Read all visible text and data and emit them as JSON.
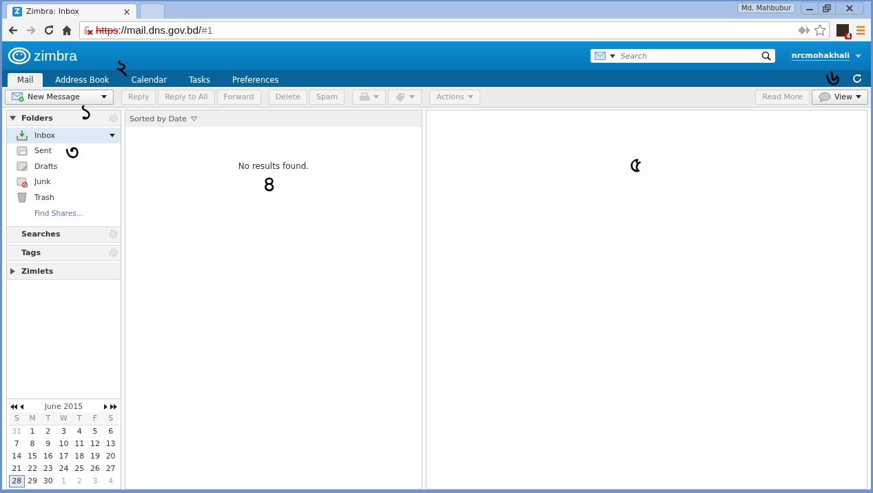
{
  "browser": {
    "tabs": [
      {
        "favicon": "Z",
        "title": "Zimbra: Inbox",
        "close": "×",
        "selected": true
      },
      {
        "selected": false
      }
    ],
    "profile": "Md. Mahbubur",
    "url": {
      "scheme": "https",
      "rest": "://mail.dns.gov.bd/",
      "hash": "#1"
    },
    "extension_badge": "4"
  },
  "header": {
    "logo": "zimbra",
    "search": {
      "placeholder": "Search"
    },
    "user": "nrcmohakhali"
  },
  "app_tabs": [
    {
      "label": "Mail",
      "selected": true
    },
    {
      "label": "Address Book",
      "selected": false
    },
    {
      "label": "Calendar",
      "selected": false
    },
    {
      "label": "Tasks",
      "selected": false
    },
    {
      "label": "Preferences",
      "selected": false
    }
  ],
  "toolbar": {
    "left": [
      {
        "kind": "text",
        "label": "New Message",
        "menu": true,
        "disabled": false
      },
      {
        "kind": "text",
        "label": "Reply",
        "disabled": true
      },
      {
        "kind": "text",
        "label": "Reply to All",
        "disabled": true
      },
      {
        "kind": "text",
        "label": "Forward",
        "disabled": true
      },
      {
        "kind": "text",
        "label": "Delete",
        "disabled": true
      },
      {
        "kind": "text",
        "label": "Spam",
        "disabled": true
      },
      {
        "kind": "icon",
        "menu": true,
        "disabled": true
      },
      {
        "kind": "icon",
        "menu": true,
        "disabled": true
      },
      {
        "kind": "text",
        "label": "Actions",
        "menu": true,
        "disabled": true
      }
    ],
    "right": [
      {
        "kind": "text",
        "label": "Read More",
        "disabled": true
      },
      {
        "kind": "text",
        "label": "View",
        "menu": true,
        "disabled": false
      }
    ]
  },
  "sidebar": {
    "folders_title": "Folders",
    "expanded": true,
    "folders": [
      {
        "name": "Inbox",
        "selected": true
      },
      {
        "name": "Sent",
        "selected": false
      },
      {
        "name": "Drafts",
        "selected": false
      },
      {
        "name": "Junk",
        "selected": false
      },
      {
        "name": "Trash",
        "selected": false
      }
    ],
    "find_shares": "Find Shares...",
    "sections": [
      {
        "title": "Searches",
        "gear": true
      },
      {
        "title": "Tags",
        "gear": true
      },
      {
        "title": "Zimlets",
        "expanded": false,
        "gear": false
      }
    ]
  },
  "calendar": {
    "month": "June 2015",
    "weekdays": [
      "S",
      "M",
      "T",
      "W",
      "T",
      "F",
      "S"
    ],
    "weeks": [
      [
        {
          "d": "31",
          "muted": true,
          "selected": false
        },
        {
          "d": "1",
          "muted": false,
          "selected": false
        },
        {
          "d": "2",
          "muted": false,
          "selected": false
        },
        {
          "d": "3",
          "muted": false,
          "selected": false
        },
        {
          "d": "4",
          "muted": false,
          "selected": false
        },
        {
          "d": "5",
          "muted": false,
          "selected": false
        },
        {
          "d": "6",
          "muted": false,
          "selected": false
        }
      ],
      [
        {
          "d": "7",
          "muted": false,
          "selected": false
        },
        {
          "d": "8",
          "muted": false,
          "selected": false
        },
        {
          "d": "9",
          "muted": false,
          "selected": false
        },
        {
          "d": "10",
          "muted": false,
          "selected": false
        },
        {
          "d": "11",
          "muted": false,
          "selected": false
        },
        {
          "d": "12",
          "muted": false,
          "selected": false
        },
        {
          "d": "13",
          "muted": false,
          "selected": false
        }
      ],
      [
        {
          "d": "14",
          "muted": false,
          "selected": false
        },
        {
          "d": "15",
          "muted": false,
          "selected": false
        },
        {
          "d": "16",
          "muted": false,
          "selected": false
        },
        {
          "d": "17",
          "muted": false,
          "selected": false
        },
        {
          "d": "18",
          "muted": false,
          "selected": false
        },
        {
          "d": "19",
          "muted": false,
          "selected": false
        },
        {
          "d": "20",
          "muted": false,
          "selected": false
        }
      ],
      [
        {
          "d": "21",
          "muted": false,
          "selected": false
        },
        {
          "d": "22",
          "muted": false,
          "selected": false
        },
        {
          "d": "23",
          "muted": false,
          "selected": false
        },
        {
          "d": "24",
          "muted": false,
          "selected": false
        },
        {
          "d": "25",
          "muted": false,
          "selected": false
        },
        {
          "d": "26",
          "muted": false,
          "selected": false
        },
        {
          "d": "27",
          "muted": false,
          "selected": false
        }
      ],
      [
        {
          "d": "28",
          "muted": false,
          "selected": true
        },
        {
          "d": "29",
          "muted": false,
          "selected": false
        },
        {
          "d": "30",
          "muted": false,
          "selected": false
        },
        {
          "d": "1",
          "muted": true,
          "selected": false
        },
        {
          "d": "2",
          "muted": true,
          "selected": false
        },
        {
          "d": "3",
          "muted": true,
          "selected": false
        },
        {
          "d": "4",
          "muted": true,
          "selected": false
        }
      ]
    ]
  },
  "message_list": {
    "sort": "Sorted by Date",
    "empty": "No results found."
  },
  "annotations": [
    "১",
    "২",
    "৩",
    "৪",
    "৫",
    "৬"
  ]
}
